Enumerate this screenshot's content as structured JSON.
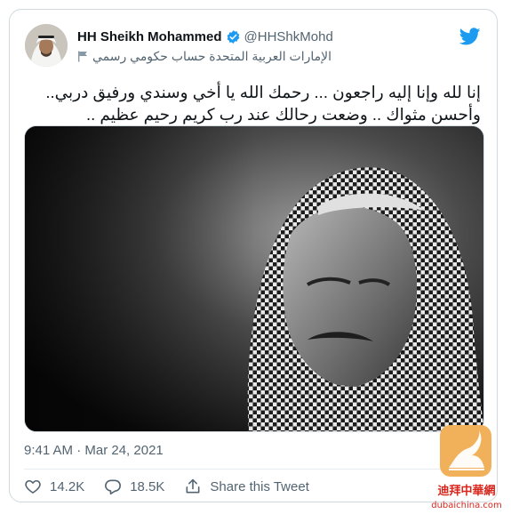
{
  "tweet": {
    "display_name": "HH Sheikh Mohammed",
    "handle": "@HHShkMohd",
    "subtitle": "الإمارات العربية المتحدة حساب حكومي رسمي",
    "text_lines": [
      "إنا لله وإنا إليه راجعون ... رحمك الله يا أخي وسندي ورفيق دربي..",
      "وأحسن مثواك .. وضعت رحالك عند رب كريم رحيم عظيم .."
    ],
    "timestamp": "9:41 AM · Mar 24, 2021"
  },
  "actions": {
    "likes": "14.2K",
    "replies": "18.5K",
    "share_label": "Share this Tweet"
  },
  "watermark": {
    "chinese": "迪拜中華網",
    "domain": "dubaichina.com"
  },
  "colors": {
    "twitter_blue": "#1d9bf0",
    "text_primary": "#0f1419",
    "text_secondary": "#536471",
    "border": "#cfd9de",
    "watermark_red": "#d9261c",
    "watermark_gold": "#f0b15a"
  },
  "icons": [
    "avatar",
    "verified-badge-icon",
    "flag-icon",
    "twitter-bird-icon",
    "heart-icon",
    "reply-bubble-icon",
    "share-icon",
    "watermark-logo"
  ]
}
